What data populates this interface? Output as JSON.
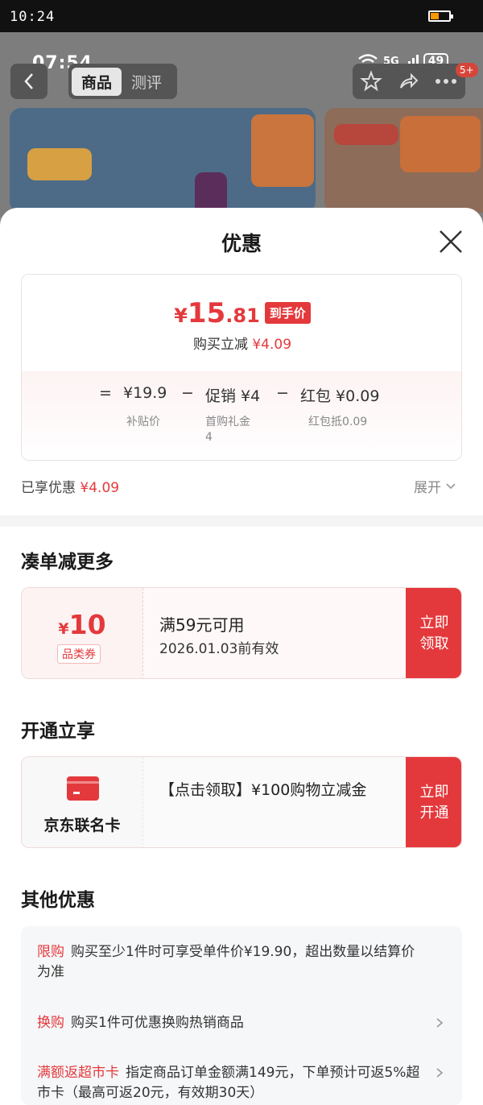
{
  "device": {
    "outer_time": "10:24",
    "inner_time": "07:54",
    "network": "5G",
    "battery": "49"
  },
  "product_nav": {
    "tabs": [
      "商品",
      "测评"
    ],
    "badge": "5+"
  },
  "sheet": {
    "title": "优惠",
    "price": {
      "yen": "¥",
      "integer": "15",
      "decimal": ".81",
      "tag": "到手价",
      "reduce_label": "购买立减",
      "reduce_value": "¥4.09"
    },
    "formula": {
      "eq": "=",
      "base_value": "¥19.9",
      "base_label": "补贴价",
      "minus1": "−",
      "promo_value": "促销 ¥4",
      "promo_label_line1": "首购礼金",
      "promo_label_line2": "4",
      "minus2": "−",
      "redpack_value": "红包 ¥0.09",
      "redpack_label": "红包抵0.09"
    },
    "enjoyed_label": "已享优惠",
    "enjoyed_value": "¥4.09",
    "expand_label": "展开",
    "section_more": {
      "title": "凑单减更多",
      "coupon": {
        "yen": "¥",
        "amount": "10",
        "tag": "品类券",
        "condition": "满59元可用",
        "expiry": "2026.01.03前有效",
        "button": "立即\n领取"
      }
    },
    "section_open": {
      "title": "开通立享",
      "card_name": "京东联名卡",
      "text": "【点击领取】¥100购物立减金",
      "button": "立即\n开通"
    },
    "section_other": {
      "title": "其他优惠",
      "rows": [
        {
          "label": "限购",
          "text": "购买至少1件时可享受单件价¥19.90，超出数量以结算价为准"
        },
        {
          "label": "换购",
          "text": "购买1件可优惠换购热销商品"
        },
        {
          "label": "满额返超市卡",
          "text": "指定商品订单金额满149元，下单预计可返5%超市卡（最高可返20元，有效期30天）"
        }
      ]
    }
  }
}
